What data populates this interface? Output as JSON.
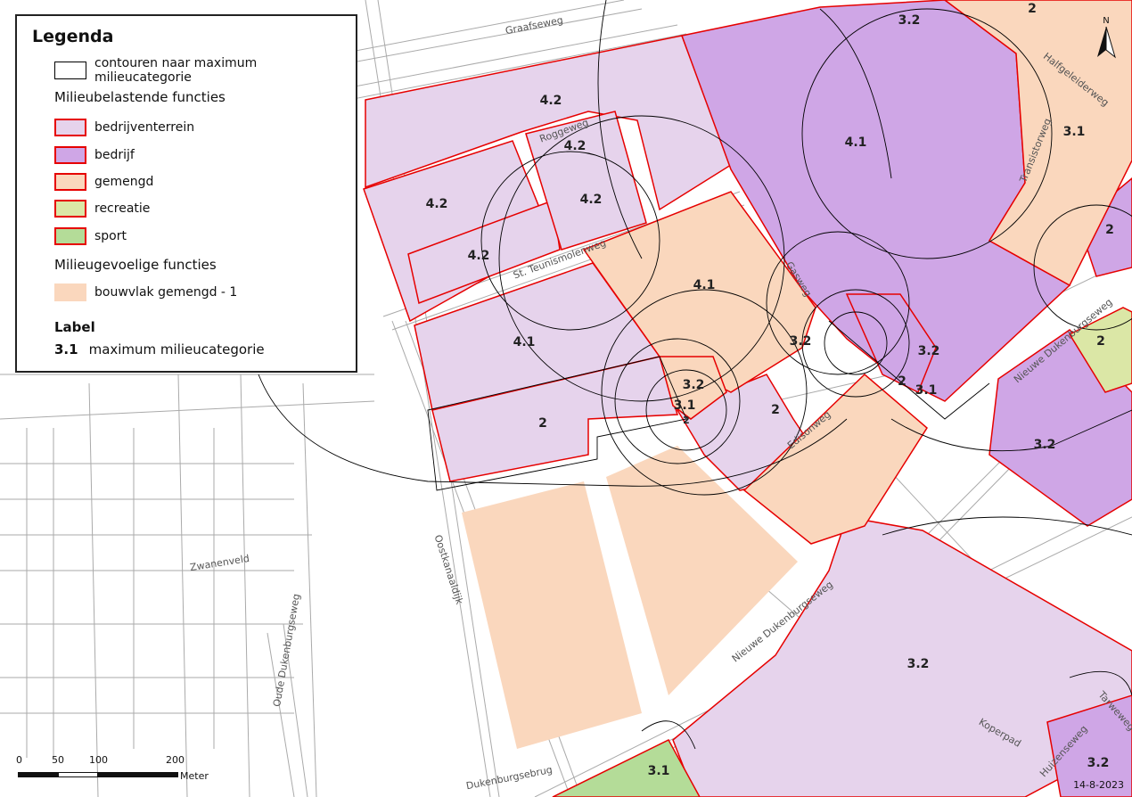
{
  "map": {
    "date": "14-8-2023",
    "north_label": "N",
    "scale": {
      "ticks": [
        "0",
        "50",
        "100",
        "200"
      ],
      "unit": "Meter"
    },
    "street_names": [
      "Graafseweg",
      "Halfgeleiderweg",
      "Transistorweg",
      "Roggeweg",
      "St. Teunismolenweg",
      "Gasweg",
      "Nieuwe Dukenburgseweg",
      "Edisonweg",
      "Oostkanaaldijk",
      "Zwanenveld",
      "Oude Dukenburgseweg",
      "Dukenburgsebrug",
      "Nieuwe Dukenburgseweg",
      "Koperpad",
      "Huizenseweg",
      "Tarweweg"
    ],
    "zone_labels": [
      "3.2",
      "2",
      "4.2",
      "4.2",
      "4.2",
      "4.2",
      "4.2",
      "4.1",
      "3.1",
      "2",
      "4.1",
      "4.1",
      "3.2",
      "3.2",
      "2",
      "3.2",
      "3.1",
      "2",
      "3.1",
      "2",
      "2",
      "3.2",
      "3.2",
      "3.1",
      "3.2"
    ],
    "colors": {
      "bedrijventerrein": "#e6d3ec",
      "bedrijf": "#cfa6e6",
      "gemengd": "#fad7bd",
      "recreatie": "#dbe7a6",
      "sport": "#b4dc98",
      "contour": "#e60000",
      "line": "#000000"
    }
  },
  "legend": {
    "title": "Legenda",
    "contour_label": "contouren naar maximum milieucategorie",
    "section1": "Milieubelastende functies",
    "items": [
      {
        "label": "bedrijventerrein",
        "fill": "#e6d3ec",
        "stroke": "#e60000"
      },
      {
        "label": "bedrijf",
        "fill": "#cfa6e6",
        "stroke": "#e60000"
      },
      {
        "label": "gemengd",
        "fill": "#fad7bd",
        "stroke": "#e60000"
      },
      {
        "label": "recreatie",
        "fill": "#dbe7a6",
        "stroke": "#e60000"
      },
      {
        "label": "sport",
        "fill": "#b4dc98",
        "stroke": "#e60000"
      }
    ],
    "section2": "Milieugevoelige functies",
    "sensitive_item": {
      "label": "bouwvlak gemengd - 1",
      "fill": "#fad7bd"
    },
    "label_heading": "Label",
    "label_example_value": "3.1",
    "label_example_text": "maximum milieucategorie"
  }
}
